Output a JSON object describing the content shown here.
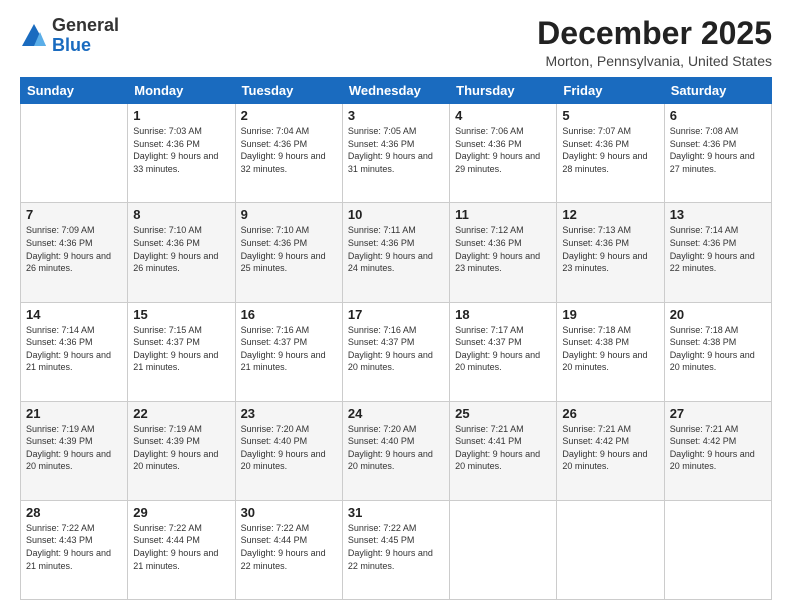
{
  "header": {
    "logo_general": "General",
    "logo_blue": "Blue",
    "month_title": "December 2025",
    "location": "Morton, Pennsylvania, United States"
  },
  "days_of_week": [
    "Sunday",
    "Monday",
    "Tuesday",
    "Wednesday",
    "Thursday",
    "Friday",
    "Saturday"
  ],
  "weeks": [
    [
      {
        "day": "",
        "sunrise": "",
        "sunset": "",
        "daylight": ""
      },
      {
        "day": "1",
        "sunrise": "Sunrise: 7:03 AM",
        "sunset": "Sunset: 4:36 PM",
        "daylight": "Daylight: 9 hours and 33 minutes."
      },
      {
        "day": "2",
        "sunrise": "Sunrise: 7:04 AM",
        "sunset": "Sunset: 4:36 PM",
        "daylight": "Daylight: 9 hours and 32 minutes."
      },
      {
        "day": "3",
        "sunrise": "Sunrise: 7:05 AM",
        "sunset": "Sunset: 4:36 PM",
        "daylight": "Daylight: 9 hours and 31 minutes."
      },
      {
        "day": "4",
        "sunrise": "Sunrise: 7:06 AM",
        "sunset": "Sunset: 4:36 PM",
        "daylight": "Daylight: 9 hours and 29 minutes."
      },
      {
        "day": "5",
        "sunrise": "Sunrise: 7:07 AM",
        "sunset": "Sunset: 4:36 PM",
        "daylight": "Daylight: 9 hours and 28 minutes."
      },
      {
        "day": "6",
        "sunrise": "Sunrise: 7:08 AM",
        "sunset": "Sunset: 4:36 PM",
        "daylight": "Daylight: 9 hours and 27 minutes."
      }
    ],
    [
      {
        "day": "7",
        "sunrise": "Sunrise: 7:09 AM",
        "sunset": "Sunset: 4:36 PM",
        "daylight": "Daylight: 9 hours and 26 minutes."
      },
      {
        "day": "8",
        "sunrise": "Sunrise: 7:10 AM",
        "sunset": "Sunset: 4:36 PM",
        "daylight": "Daylight: 9 hours and 26 minutes."
      },
      {
        "day": "9",
        "sunrise": "Sunrise: 7:10 AM",
        "sunset": "Sunset: 4:36 PM",
        "daylight": "Daylight: 9 hours and 25 minutes."
      },
      {
        "day": "10",
        "sunrise": "Sunrise: 7:11 AM",
        "sunset": "Sunset: 4:36 PM",
        "daylight": "Daylight: 9 hours and 24 minutes."
      },
      {
        "day": "11",
        "sunrise": "Sunrise: 7:12 AM",
        "sunset": "Sunset: 4:36 PM",
        "daylight": "Daylight: 9 hours and 23 minutes."
      },
      {
        "day": "12",
        "sunrise": "Sunrise: 7:13 AM",
        "sunset": "Sunset: 4:36 PM",
        "daylight": "Daylight: 9 hours and 23 minutes."
      },
      {
        "day": "13",
        "sunrise": "Sunrise: 7:14 AM",
        "sunset": "Sunset: 4:36 PM",
        "daylight": "Daylight: 9 hours and 22 minutes."
      }
    ],
    [
      {
        "day": "14",
        "sunrise": "Sunrise: 7:14 AM",
        "sunset": "Sunset: 4:36 PM",
        "daylight": "Daylight: 9 hours and 21 minutes."
      },
      {
        "day": "15",
        "sunrise": "Sunrise: 7:15 AM",
        "sunset": "Sunset: 4:37 PM",
        "daylight": "Daylight: 9 hours and 21 minutes."
      },
      {
        "day": "16",
        "sunrise": "Sunrise: 7:16 AM",
        "sunset": "Sunset: 4:37 PM",
        "daylight": "Daylight: 9 hours and 21 minutes."
      },
      {
        "day": "17",
        "sunrise": "Sunrise: 7:16 AM",
        "sunset": "Sunset: 4:37 PM",
        "daylight": "Daylight: 9 hours and 20 minutes."
      },
      {
        "day": "18",
        "sunrise": "Sunrise: 7:17 AM",
        "sunset": "Sunset: 4:37 PM",
        "daylight": "Daylight: 9 hours and 20 minutes."
      },
      {
        "day": "19",
        "sunrise": "Sunrise: 7:18 AM",
        "sunset": "Sunset: 4:38 PM",
        "daylight": "Daylight: 9 hours and 20 minutes."
      },
      {
        "day": "20",
        "sunrise": "Sunrise: 7:18 AM",
        "sunset": "Sunset: 4:38 PM",
        "daylight": "Daylight: 9 hours and 20 minutes."
      }
    ],
    [
      {
        "day": "21",
        "sunrise": "Sunrise: 7:19 AM",
        "sunset": "Sunset: 4:39 PM",
        "daylight": "Daylight: 9 hours and 20 minutes."
      },
      {
        "day": "22",
        "sunrise": "Sunrise: 7:19 AM",
        "sunset": "Sunset: 4:39 PM",
        "daylight": "Daylight: 9 hours and 20 minutes."
      },
      {
        "day": "23",
        "sunrise": "Sunrise: 7:20 AM",
        "sunset": "Sunset: 4:40 PM",
        "daylight": "Daylight: 9 hours and 20 minutes."
      },
      {
        "day": "24",
        "sunrise": "Sunrise: 7:20 AM",
        "sunset": "Sunset: 4:40 PM",
        "daylight": "Daylight: 9 hours and 20 minutes."
      },
      {
        "day": "25",
        "sunrise": "Sunrise: 7:21 AM",
        "sunset": "Sunset: 4:41 PM",
        "daylight": "Daylight: 9 hours and 20 minutes."
      },
      {
        "day": "26",
        "sunrise": "Sunrise: 7:21 AM",
        "sunset": "Sunset: 4:42 PM",
        "daylight": "Daylight: 9 hours and 20 minutes."
      },
      {
        "day": "27",
        "sunrise": "Sunrise: 7:21 AM",
        "sunset": "Sunset: 4:42 PM",
        "daylight": "Daylight: 9 hours and 20 minutes."
      }
    ],
    [
      {
        "day": "28",
        "sunrise": "Sunrise: 7:22 AM",
        "sunset": "Sunset: 4:43 PM",
        "daylight": "Daylight: 9 hours and 21 minutes."
      },
      {
        "day": "29",
        "sunrise": "Sunrise: 7:22 AM",
        "sunset": "Sunset: 4:44 PM",
        "daylight": "Daylight: 9 hours and 21 minutes."
      },
      {
        "day": "30",
        "sunrise": "Sunrise: 7:22 AM",
        "sunset": "Sunset: 4:44 PM",
        "daylight": "Daylight: 9 hours and 22 minutes."
      },
      {
        "day": "31",
        "sunrise": "Sunrise: 7:22 AM",
        "sunset": "Sunset: 4:45 PM",
        "daylight": "Daylight: 9 hours and 22 minutes."
      },
      {
        "day": "",
        "sunrise": "",
        "sunset": "",
        "daylight": ""
      },
      {
        "day": "",
        "sunrise": "",
        "sunset": "",
        "daylight": ""
      },
      {
        "day": "",
        "sunrise": "",
        "sunset": "",
        "daylight": ""
      }
    ]
  ]
}
